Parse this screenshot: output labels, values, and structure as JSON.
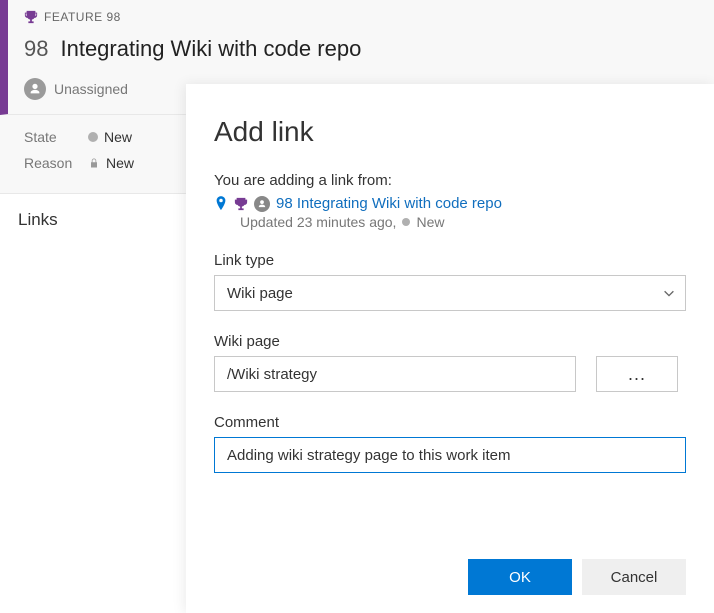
{
  "feature": {
    "tag": "FEATURE 98",
    "id": "98",
    "title": "Integrating Wiki with code repo",
    "assignee": "Unassigned",
    "state_label": "State",
    "state_value": "New",
    "reason_label": "Reason",
    "reason_value": "New"
  },
  "links_section": "Links",
  "dialog": {
    "title": "Add link",
    "adding_from": "You are adding a link from:",
    "ref_text": "98 Integrating Wiki with code repo",
    "updated": "Updated 23 minutes ago,",
    "ref_state": "New",
    "link_type_label": "Link type",
    "link_type_value": "Wiki page",
    "wiki_label": "Wiki page",
    "wiki_value": "/Wiki strategy",
    "browse_label": "...",
    "comment_label": "Comment",
    "comment_value": "Adding wiki strategy page to this work item",
    "ok": "OK",
    "cancel": "Cancel"
  },
  "colors": {
    "accent": "#773b93",
    "primary": "#0078d4"
  }
}
